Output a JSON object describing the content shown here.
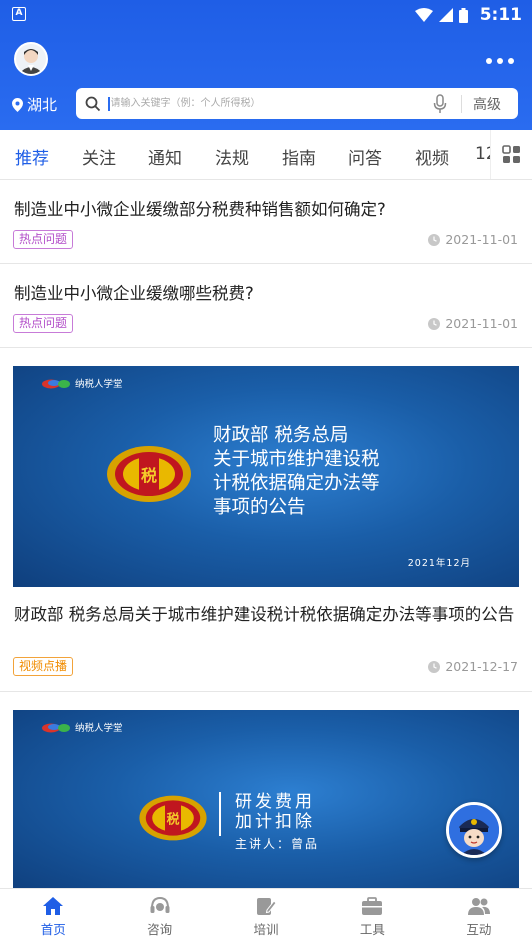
{
  "status_bar": {
    "time": "5:11",
    "app_icon_letter": "A"
  },
  "header": {
    "location": "湖北",
    "search_placeholder": "请输入关键字（例：个人所得税）",
    "advanced_label": "高级",
    "accent_color": "#1f5ee6"
  },
  "tabs": [
    {
      "label": "推荐",
      "active": true
    },
    {
      "label": "关注"
    },
    {
      "label": "通知"
    },
    {
      "label": "法规"
    },
    {
      "label": "指南"
    },
    {
      "label": "问答"
    },
    {
      "label": "视频"
    },
    {
      "label": "12"
    }
  ],
  "articles": [
    {
      "title": "制造业中小微企业缓缴部分税费种销售额如何确定?",
      "tag": "热点问题",
      "date": "2021-11-01"
    },
    {
      "title": "制造业中小微企业缓缴哪些税费?",
      "tag": "热点问题",
      "date": "2021-11-01"
    },
    {
      "banner_brand": "纳税人学堂",
      "banner_title_lines": [
        "财政部 税务总局",
        "关于城市维护建设税",
        "计税依据确定办法等",
        "事项的公告"
      ],
      "banner_date": "2021年12月",
      "title": "财政部 税务总局关于城市维护建设税计税依据确定办法等事项的公告",
      "tag": "视频点播",
      "date": "2021-12-17"
    },
    {
      "banner_brand": "纳税人学堂",
      "banner_title_line1": "研发费用",
      "banner_title_line2": "加计扣除",
      "banner_speaker": "主讲人：曾品"
    }
  ],
  "bottom_nav": [
    {
      "label": "首页",
      "icon": "home-icon",
      "active": true
    },
    {
      "label": "咨询",
      "icon": "headset-icon"
    },
    {
      "label": "培训",
      "icon": "edit-icon"
    },
    {
      "label": "工具",
      "icon": "toolbox-icon"
    },
    {
      "label": "互动",
      "icon": "people-icon"
    }
  ]
}
